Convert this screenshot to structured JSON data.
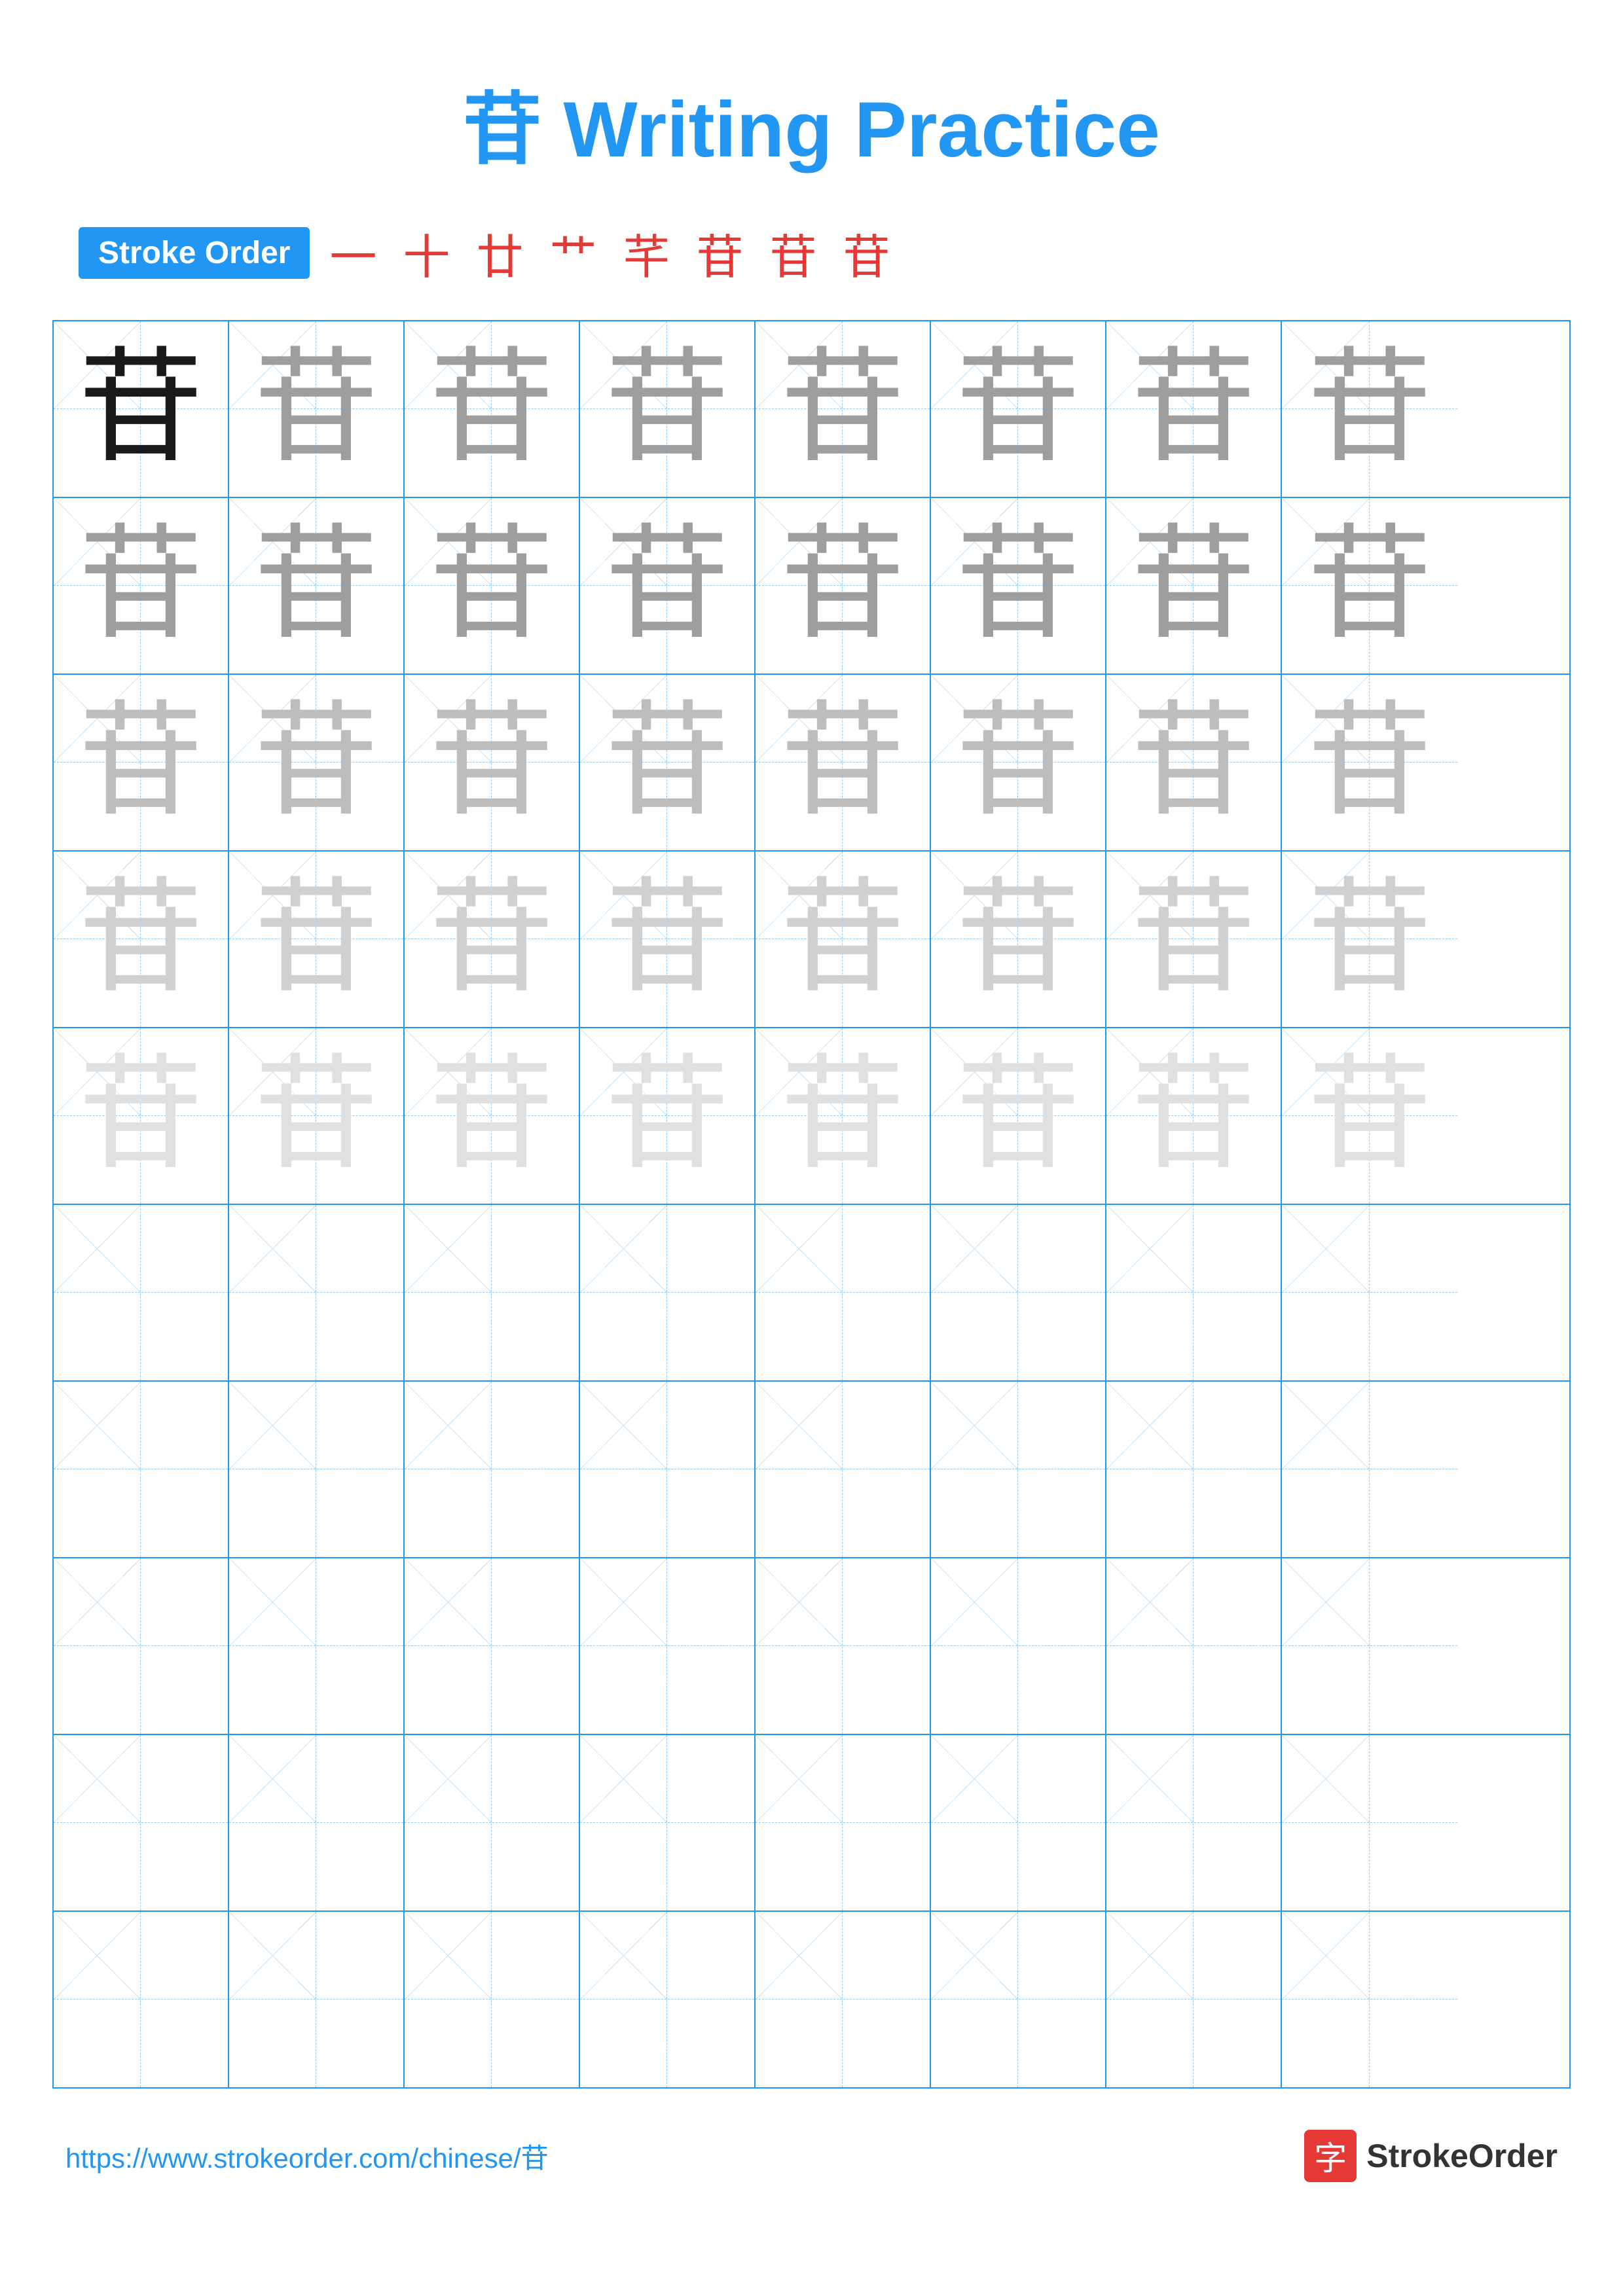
{
  "page": {
    "title": "苷 Writing Practice",
    "character": "苷"
  },
  "stroke_order": {
    "badge_label": "Stroke Order",
    "strokes": [
      "一",
      "十",
      "廿",
      "艹",
      "芊",
      "苷",
      "苷",
      "苷"
    ]
  },
  "grid": {
    "rows": 10,
    "cols": 8,
    "row_opacity": [
      {
        "chars": [
          "dark",
          "medium",
          "medium",
          "medium",
          "medium",
          "medium",
          "medium",
          "medium"
        ]
      },
      {
        "chars": [
          "medium",
          "medium",
          "medium",
          "medium",
          "medium",
          "medium",
          "medium",
          "medium"
        ]
      },
      {
        "chars": [
          "light",
          "light",
          "light",
          "light",
          "light",
          "light",
          "light",
          "light"
        ]
      },
      {
        "chars": [
          "lighter",
          "lighter",
          "lighter",
          "lighter",
          "lighter",
          "lighter",
          "lighter",
          "lighter"
        ]
      },
      {
        "chars": [
          "lightest",
          "lightest",
          "lightest",
          "lightest",
          "lightest",
          "lightest",
          "lightest",
          "lightest"
        ]
      },
      {
        "chars": [
          "empty",
          "empty",
          "empty",
          "empty",
          "empty",
          "empty",
          "empty",
          "empty"
        ]
      },
      {
        "chars": [
          "empty",
          "empty",
          "empty",
          "empty",
          "empty",
          "empty",
          "empty",
          "empty"
        ]
      },
      {
        "chars": [
          "empty",
          "empty",
          "empty",
          "empty",
          "empty",
          "empty",
          "empty",
          "empty"
        ]
      },
      {
        "chars": [
          "empty",
          "empty",
          "empty",
          "empty",
          "empty",
          "empty",
          "empty",
          "empty"
        ]
      },
      {
        "chars": [
          "empty",
          "empty",
          "empty",
          "empty",
          "empty",
          "empty",
          "empty",
          "empty"
        ]
      }
    ]
  },
  "footer": {
    "url": "https://www.strokeorder.com/chinese/苷",
    "logo_char": "字",
    "logo_text": "StrokeOrder"
  }
}
